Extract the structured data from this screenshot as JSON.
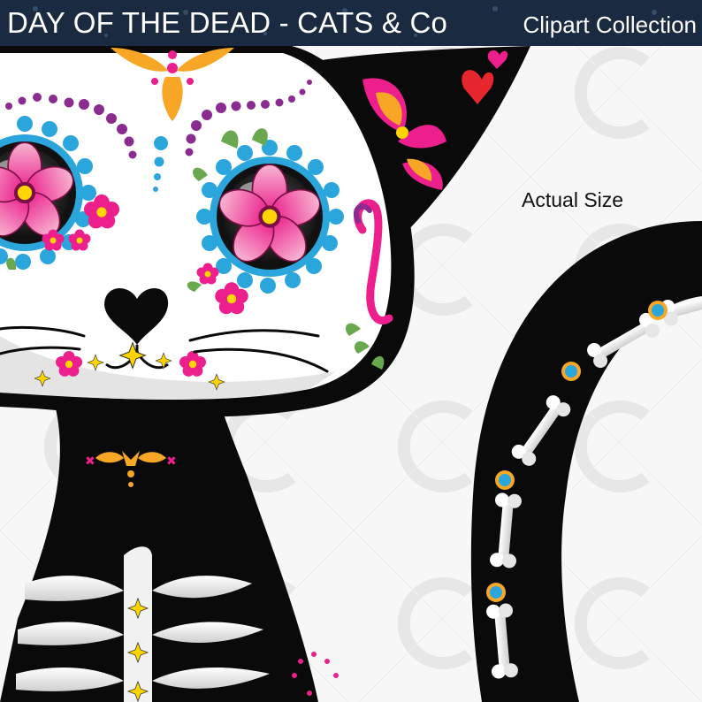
{
  "banner": {
    "title": "DAY OF THE DEAD - CATS & Co",
    "subtitle": "Clipart Collection"
  },
  "caption": {
    "size_label": "Actual Size"
  },
  "artwork": {
    "subject": "sugar-skull-cat-illustration",
    "watermark": "c-logo-watermark",
    "colors": {
      "banner": "#1a2a40",
      "body": "#0a0a0a",
      "face": "#ffffff",
      "pink": "#ec1f8c",
      "orange": "#f7a626",
      "blue": "#2aa6dd",
      "yellow": "#ffd400",
      "purple": "#8a2b8f",
      "red": "#e8262e",
      "green": "#6aa84f"
    }
  }
}
